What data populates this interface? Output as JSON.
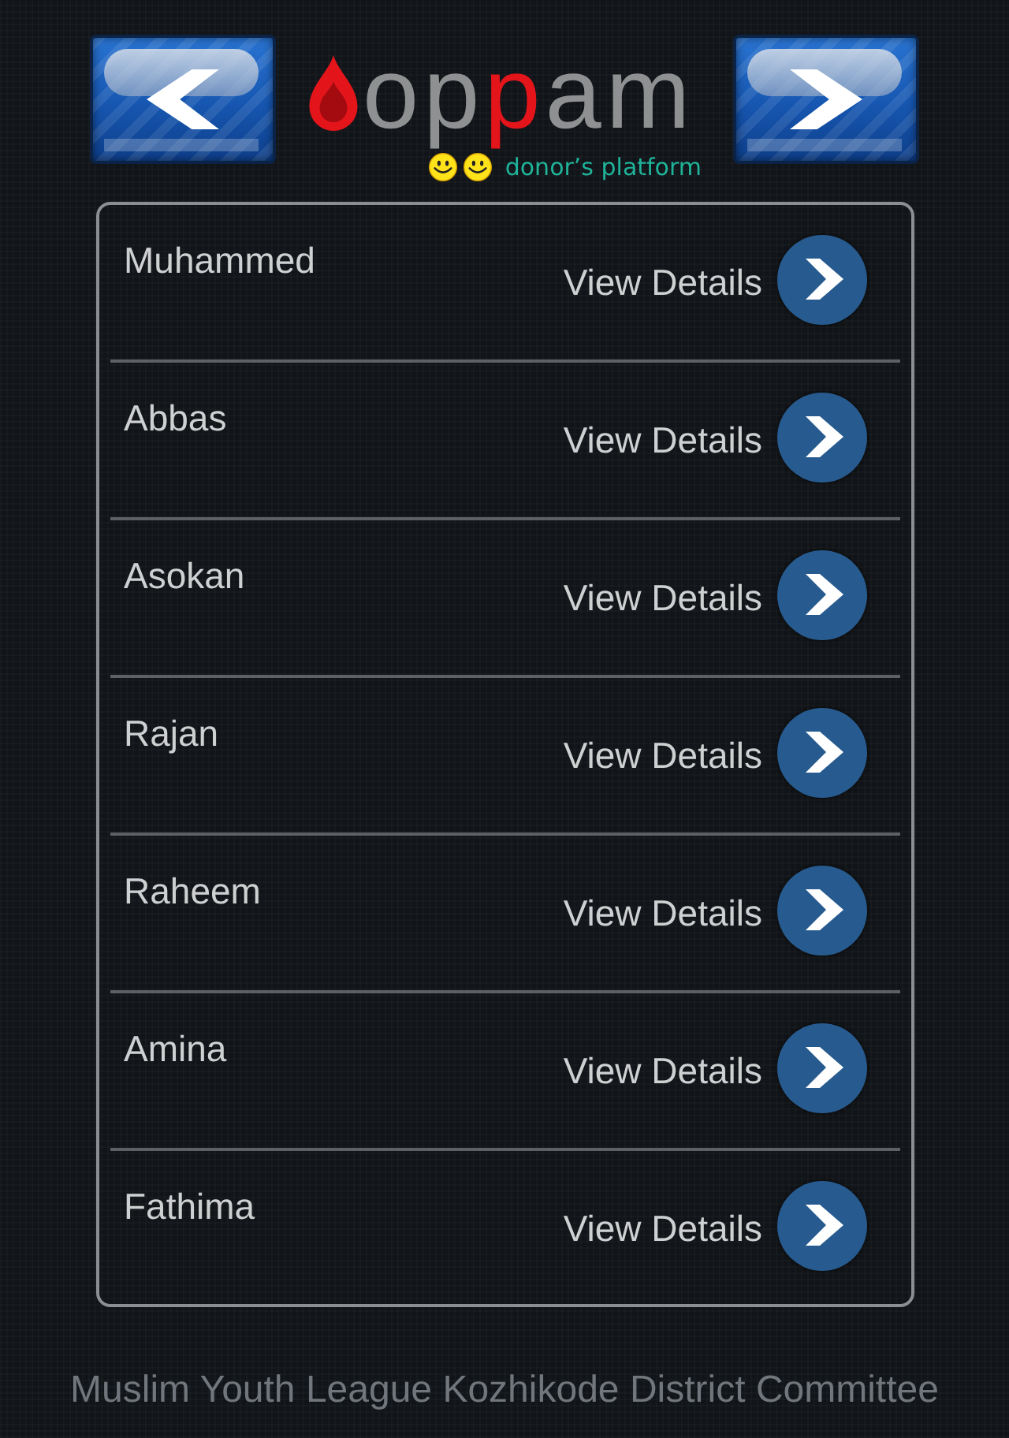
{
  "nav_buttons": [
    {
      "kind": "back"
    },
    {
      "kind": "forward"
    }
  ],
  "logo": {
    "wordmark": "oppam",
    "tagline": "donor’s platform"
  },
  "donors": [
    {
      "name": "Muhammed",
      "action": "View Details"
    },
    {
      "name": "Abbas",
      "action": "View Details"
    },
    {
      "name": "Asokan",
      "action": "View Details"
    },
    {
      "name": "Rajan",
      "action": "View Details"
    },
    {
      "name": "Raheem",
      "action": "View Details"
    },
    {
      "name": "Amina",
      "action": "View Details"
    },
    {
      "name": "Fathima",
      "action": "View Details"
    }
  ],
  "footer": {
    "text": "Muslim Youth League Kozhikode District Committee"
  }
}
